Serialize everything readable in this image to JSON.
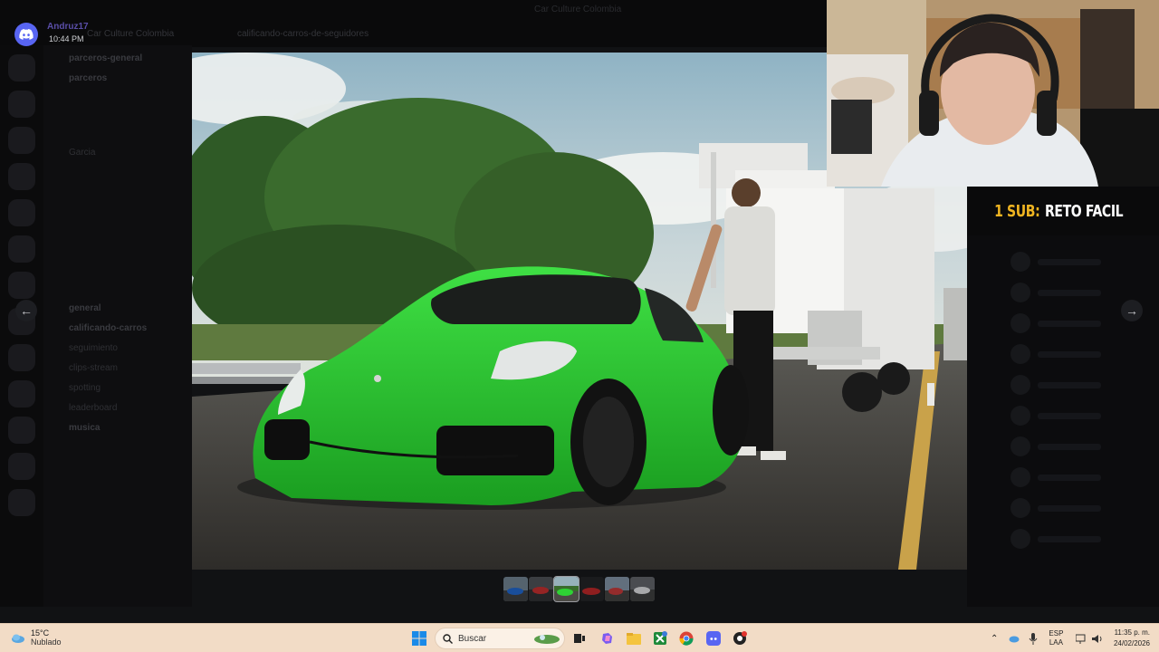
{
  "window": {
    "caption": "Car Culture Colombia"
  },
  "discord": {
    "user_name": "Andruz17",
    "message_time": "10:44 PM",
    "server_name": "Car Culture Colombia",
    "channel_header": "calificando-carros-de-seguidores",
    "channels": [
      {
        "label": "parceros-general",
        "bold": true
      },
      {
        "label": "parceros",
        "bold": true
      },
      {
        "label": "Garcia",
        "bold": false
      },
      {
        "label": "general",
        "bold": true
      },
      {
        "label": "calificando-carros",
        "bold": true
      },
      {
        "label": "seguimiento",
        "bold": false
      },
      {
        "label": "clips-stream",
        "bold": false
      },
      {
        "label": "spotting",
        "bold": false
      },
      {
        "label": "leaderboard",
        "bold": false
      },
      {
        "label": "musica",
        "bold": true
      }
    ]
  },
  "stream_overlay": {
    "sub_goal_label": "1 SUB:",
    "sub_goal_text": "RETO FACIL"
  },
  "taskbar": {
    "weather_temp": "15°C",
    "weather_desc": "Nublado",
    "search_placeholder": "Buscar",
    "lang_top": "ESP",
    "lang_bottom": "LAA",
    "time": "11:35 p. m.",
    "date": "24/02/2026"
  },
  "colors": {
    "discord_blurple": "#5865f2",
    "sub_goal_accent": "#f0b521",
    "car_green": "#27c22e",
    "taskbar_bg": "#f2dcc6"
  }
}
